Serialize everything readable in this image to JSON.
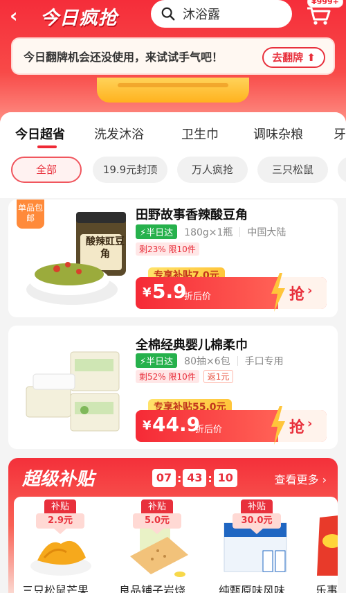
{
  "header": {
    "brand_title": "今日疯抢",
    "search_text": "沐浴露",
    "cart_badge": "¥999+"
  },
  "flip_banner": {
    "message": "今日翻牌机会还没使用，来试试手气吧！",
    "button_label": "去翻牌"
  },
  "tabs": [
    "今日超省",
    "洗发沐浴",
    "卫生巾",
    "调味杂粮",
    "牙"
  ],
  "active_tab": 0,
  "chips": [
    "全部",
    "19.9元封顶",
    "万人疯抢",
    "三只松鼠"
  ],
  "products": [
    {
      "title": "田野故事香辣酸豆角",
      "corner_tag": "单品包邮",
      "jar_label": "酸辣豇豆角",
      "delivery": "半日达",
      "spec": "180g×1瓶",
      "origin": "中国大陆",
      "stock": "剩23% 限10件",
      "extra_tag": "",
      "subsidy": "专享补贴7.0元",
      "currency": "¥",
      "price": "5.9",
      "price_label": "折后价",
      "buy_label": "抢"
    },
    {
      "title": "全棉经典婴儿棉柔巾",
      "corner_tag": "",
      "jar_label": "",
      "delivery": "半日达",
      "spec": "80抽×6包",
      "origin": "手口专用",
      "stock": "剩52% 限10件",
      "extra_tag": "返1元",
      "subsidy": "专享补贴55.0元",
      "currency": "¥",
      "price": "44.9",
      "price_label": "折后价",
      "buy_label": "抢"
    }
  ],
  "super_subsidy": {
    "title": "超级补贴",
    "timer": [
      "07",
      "43",
      "10"
    ],
    "more_label": "查看更多",
    "items": [
      {
        "badge_top": "补贴",
        "badge_value": "2.9元",
        "name": "三只松鼠芒果"
      },
      {
        "badge_top": "补贴",
        "badge_value": "5.0元",
        "name": "良品铺子岩烧"
      },
      {
        "badge_top": "补贴",
        "badge_value": "30.0元",
        "name": "纯甄原味风味"
      },
      {
        "badge_top": "",
        "badge_value": "",
        "name": "乐事"
      }
    ]
  },
  "colors": {
    "accent": "#ef2a36",
    "fast_green": "#26b14c",
    "gold": "#ffc53a"
  }
}
